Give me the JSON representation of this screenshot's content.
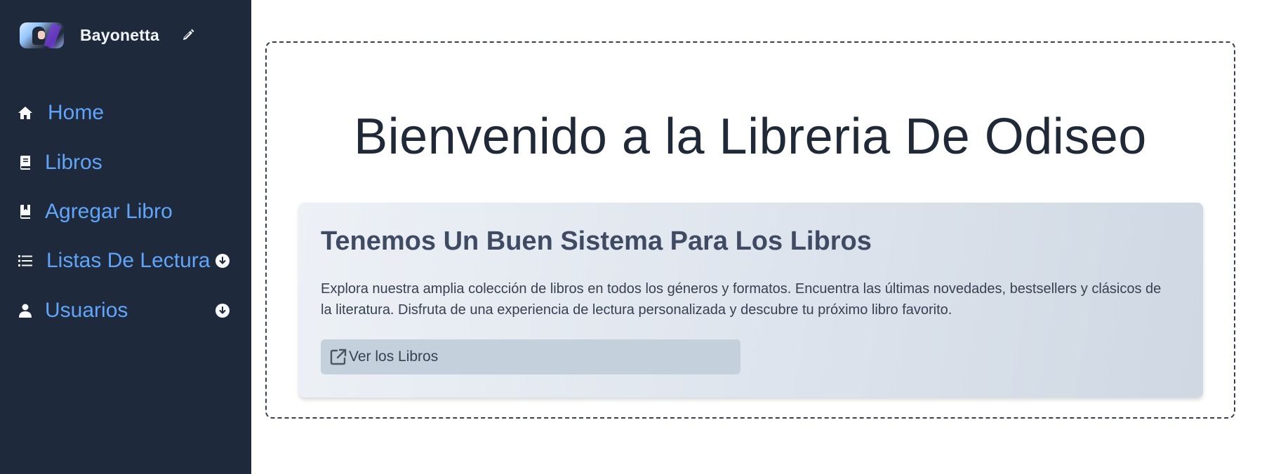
{
  "user": {
    "name": "Bayonetta",
    "avatar_icon": "avatar-image",
    "edit_icon": "pencil-icon"
  },
  "sidebar": {
    "background": "#1e293b",
    "link_color": "#60a5fa",
    "items": [
      {
        "label": "Home",
        "icon": "home-icon"
      },
      {
        "label": "Libros",
        "icon": "book-icon"
      },
      {
        "label": "Agregar Libro",
        "icon": "bookmark-book-icon"
      },
      {
        "label": "Listas De Lectura",
        "icon": "list-icon",
        "expand_icon": "arrow-down-circle-icon"
      },
      {
        "label": "Usuarios",
        "icon": "user-icon",
        "expand_icon": "arrow-down-circle-icon"
      }
    ]
  },
  "main": {
    "title": "Bienvenido a la Libreria De Odiseo",
    "card": {
      "heading": "Tenemos Un Buen Sistema Para Los Libros",
      "text": "Explora nuestra amplia colección de libros en todos los géneros y formatos. Encuentra las últimas novedades, bestsellers y clásicos de la literatura. Disfruta de una experiencia de lectura personalizada y descubre tu próximo libro favorito.",
      "button_label": "Ver los Libros",
      "button_icon": "external-link-icon"
    }
  }
}
